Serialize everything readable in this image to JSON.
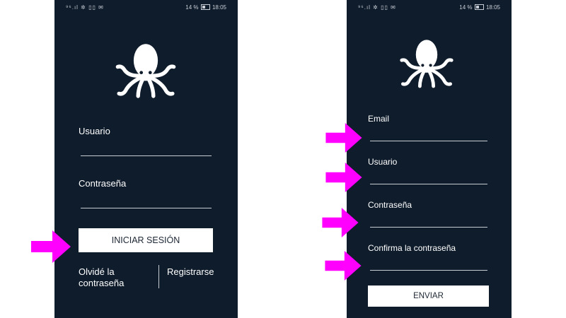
{
  "login_screen": {
    "status_icons": "⁹⁶.ıl ✲ ▯▯ ✉",
    "status_battery": "14 %",
    "status_time": "18:05",
    "username_label": "Usuario",
    "password_label": "Contraseña",
    "login_button": "INICIAR SESIÓN",
    "forgot_password_link": "Olvidé la contraseña",
    "register_link": "Registrarse"
  },
  "register_screen": {
    "status_icons": "⁹⁶.ıl ✲ ▯▯ ✉",
    "status_battery": "14 %",
    "status_time": "18:05",
    "email_label": "Email",
    "username_label": "Usuario",
    "password_label": "Contraseña",
    "confirm_password_label": "Confirma la contraseña",
    "send_button": "ENVIAR"
  },
  "colors": {
    "screen_background": "#0f1c2c",
    "annotation_arrow": "#ff00ff",
    "button_background": "#ffffff"
  },
  "icons": {
    "logo": "octopus-icon",
    "arrow": "magenta-arrow-icon"
  }
}
